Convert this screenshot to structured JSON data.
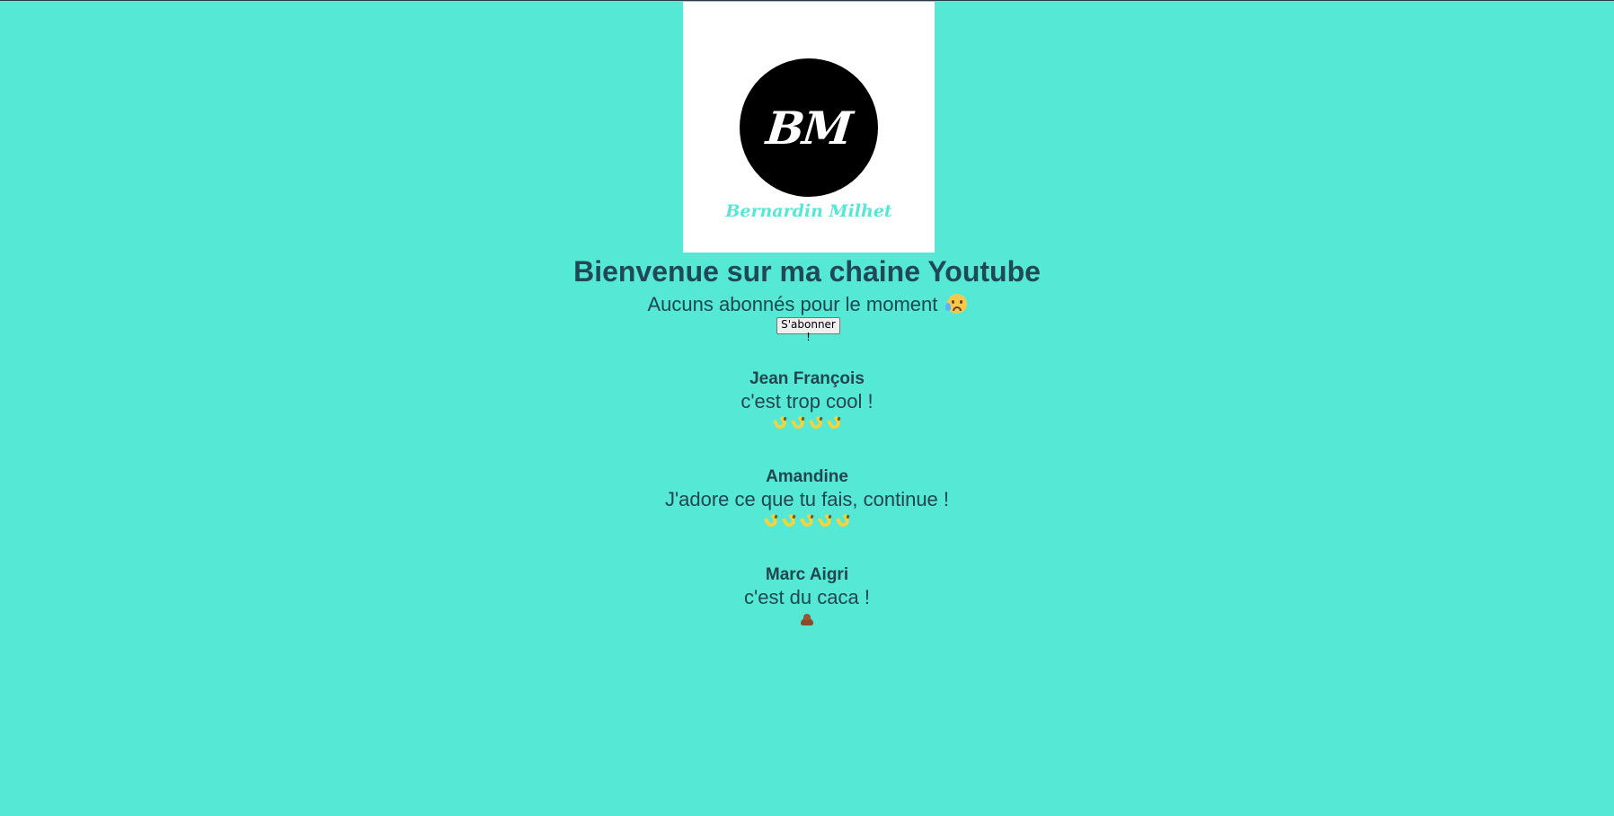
{
  "logo": {
    "initials": "BM",
    "caption": "Bernardin Milhet"
  },
  "header": {
    "title": "Bienvenue sur ma chaine Youtube",
    "subtitle": "Aucuns abonnés pour le moment",
    "subtitle_emoji": "sad-tear-face-icon"
  },
  "subscribe": {
    "label": "S'abonner !"
  },
  "comments": [
    {
      "author": "Jean François",
      "text": "c'est trop cool !",
      "rating_icon": "banana-icon",
      "rating_count": 4
    },
    {
      "author": "Amandine",
      "text": "J'adore ce que tu fais, continue !",
      "rating_icon": "banana-icon",
      "rating_count": 5
    },
    {
      "author": "Marc Aigri",
      "text": "c'est du caca !",
      "rating_icon": "poop-icon",
      "rating_count": 1
    }
  ],
  "colors": {
    "background": "#55e8d4",
    "text": "#22464f",
    "logo_circle": "#000000",
    "logo_caption": "#55e8d4"
  }
}
